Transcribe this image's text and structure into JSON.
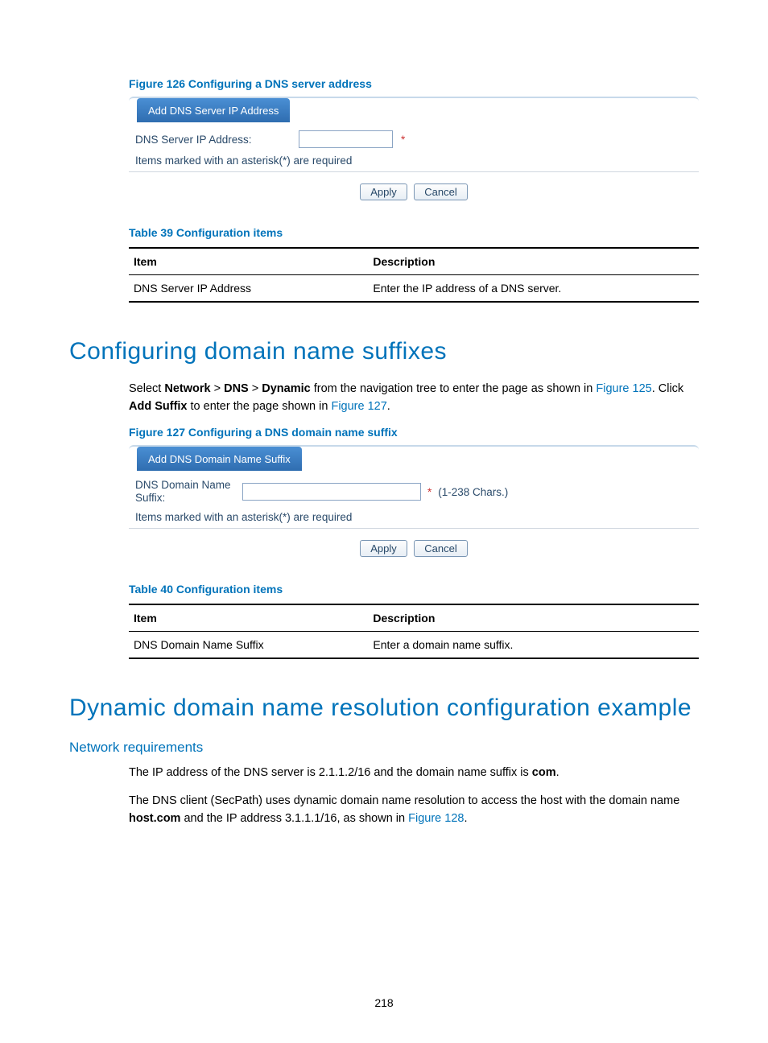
{
  "fig126": {
    "caption": "Figure 126 Configuring a DNS server address",
    "panel_title": "Add DNS Server IP Address",
    "field_label": "DNS Server IP Address:",
    "required_note": "Items marked with an asterisk(*) are required",
    "apply": "Apply",
    "cancel": "Cancel"
  },
  "table39": {
    "caption": "Table 39 Configuration items",
    "head_item": "Item",
    "head_desc": "Description",
    "row_item": "DNS Server IP Address",
    "row_desc": "Enter the IP address of a DNS server."
  },
  "sec1": {
    "heading": "Configuring domain name suffixes",
    "para1_a": "Select ",
    "para1_nav1": "Network",
    "para1_gt": " > ",
    "para1_nav2": "DNS",
    "para1_nav3": "Dynamic",
    "para1_b": " from the navigation tree to enter the page as shown in ",
    "para1_link1": "Figure 125",
    "para1_c": ". Click ",
    "para1_add": "Add Suffix",
    "para1_d": " to enter the page shown in ",
    "para1_link2": "Figure 127",
    "para1_e": "."
  },
  "fig127": {
    "caption": "Figure 127 Configuring a DNS domain name suffix",
    "panel_title": "Add DNS Domain Name Suffix",
    "field_label": "DNS Domain Name Suffix:",
    "hint": "(1-238 Chars.)",
    "required_note": "Items marked with an asterisk(*) are required",
    "apply": "Apply",
    "cancel": "Cancel"
  },
  "table40": {
    "caption": "Table 40 Configuration items",
    "head_item": "Item",
    "head_desc": "Description",
    "row_item": "DNS Domain Name Suffix",
    "row_desc": "Enter a domain name suffix."
  },
  "sec2": {
    "heading": "Dynamic domain name resolution configuration example",
    "sub": "Network requirements",
    "p1_a": "The IP address of the DNS server is 2.1.1.2/16 and the domain name suffix is ",
    "p1_b": "com",
    "p1_c": ".",
    "p2_a": "The DNS client (SecPath) uses dynamic domain name resolution to access the host with the domain name ",
    "p2_b": "host.com",
    "p2_c": " and the IP address 3.1.1.1/16, as shown in ",
    "p2_link": "Figure 128",
    "p2_d": "."
  },
  "pagenum": "218"
}
